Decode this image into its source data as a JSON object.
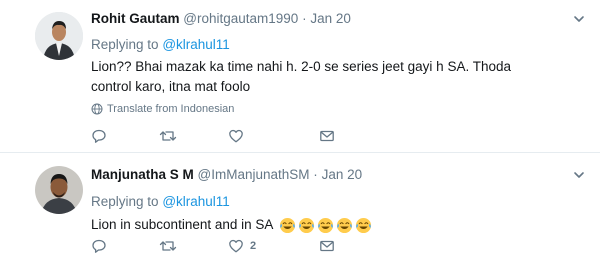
{
  "tweets": [
    {
      "fullname": "Rohit Gautam",
      "handle": "@rohitgautam1990",
      "separator": "·",
      "time": "Jan 20",
      "replying_prefix": "Replying to",
      "replying_to": "@klrahul11",
      "text": "Lion?? Bhai mazak ka time nahi h. 2-0 se series jeet gayi h SA. Thoda control karo, itna mat foolo",
      "translate_label": "Translate from Indonesian",
      "reply_count": "",
      "retweet_count": "",
      "like_count": ""
    },
    {
      "fullname": "Manjunatha S M",
      "handle": "@ImManjunathSM",
      "separator": "·",
      "time": "Jan 20",
      "replying_prefix": "Replying to",
      "replying_to": "@klrahul11",
      "text": "Lion in subcontinent and in SA",
      "emoji": [
        "face-with-tears-of-joy",
        "face-with-tears-of-joy",
        "face-with-tears-of-joy",
        "face-with-tears-of-joy",
        "face-with-tears-of-joy"
      ],
      "reply_count": "",
      "retweet_count": "",
      "like_count": "2"
    }
  ],
  "icons": {
    "reply": "reply-icon",
    "retweet": "retweet-icon",
    "like": "heart-icon",
    "dm": "envelope-icon",
    "more": "chevron-down-icon",
    "translate": "globe-icon"
  },
  "colors": {
    "link": "#1b95e0",
    "muted": "#657786",
    "text": "#14171a",
    "divider": "#e6ecf0"
  }
}
